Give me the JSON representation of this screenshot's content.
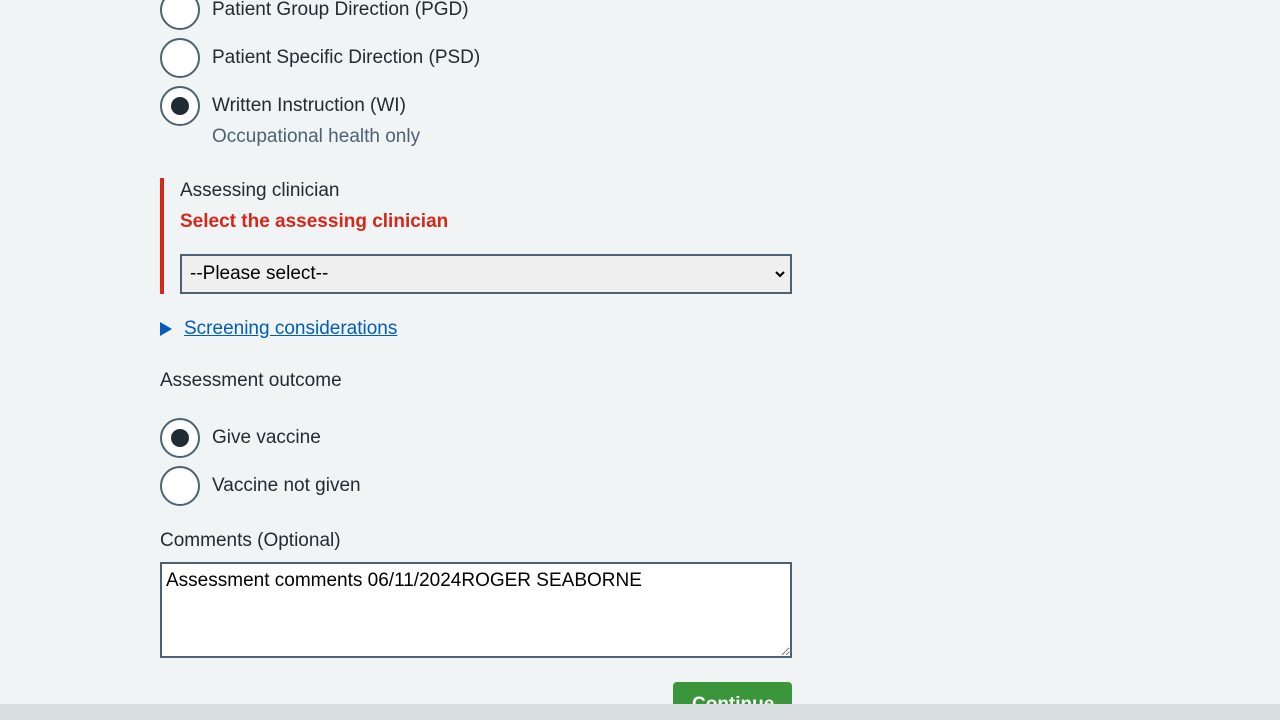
{
  "direction": {
    "options": [
      {
        "label": "Patient Group Direction (PGD)",
        "checked": false
      },
      {
        "label": "Patient Specific Direction (PSD)",
        "checked": false
      },
      {
        "label": "Written Instruction (WI)",
        "checked": true,
        "hint": "Occupational health only"
      }
    ]
  },
  "assessing_clinician": {
    "label": "Assessing clinician",
    "error": "Select the assessing clinician",
    "selected": "--Please select--"
  },
  "screening": {
    "link": "Screening considerations"
  },
  "outcome": {
    "label": "Assessment outcome",
    "options": [
      {
        "label": "Give vaccine",
        "checked": true
      },
      {
        "label": "Vaccine not given",
        "checked": false
      }
    ]
  },
  "comments": {
    "label": "Comments (Optional)",
    "value": "Assessment comments 06/11/2024ROGER SEABORNE"
  },
  "actions": {
    "continue_label": "Continue"
  },
  "colors": {
    "background": "#f0f4f5",
    "error": "#d5281b",
    "link": "#005eb8",
    "button": "#3b963b",
    "border": "#4c6272"
  }
}
